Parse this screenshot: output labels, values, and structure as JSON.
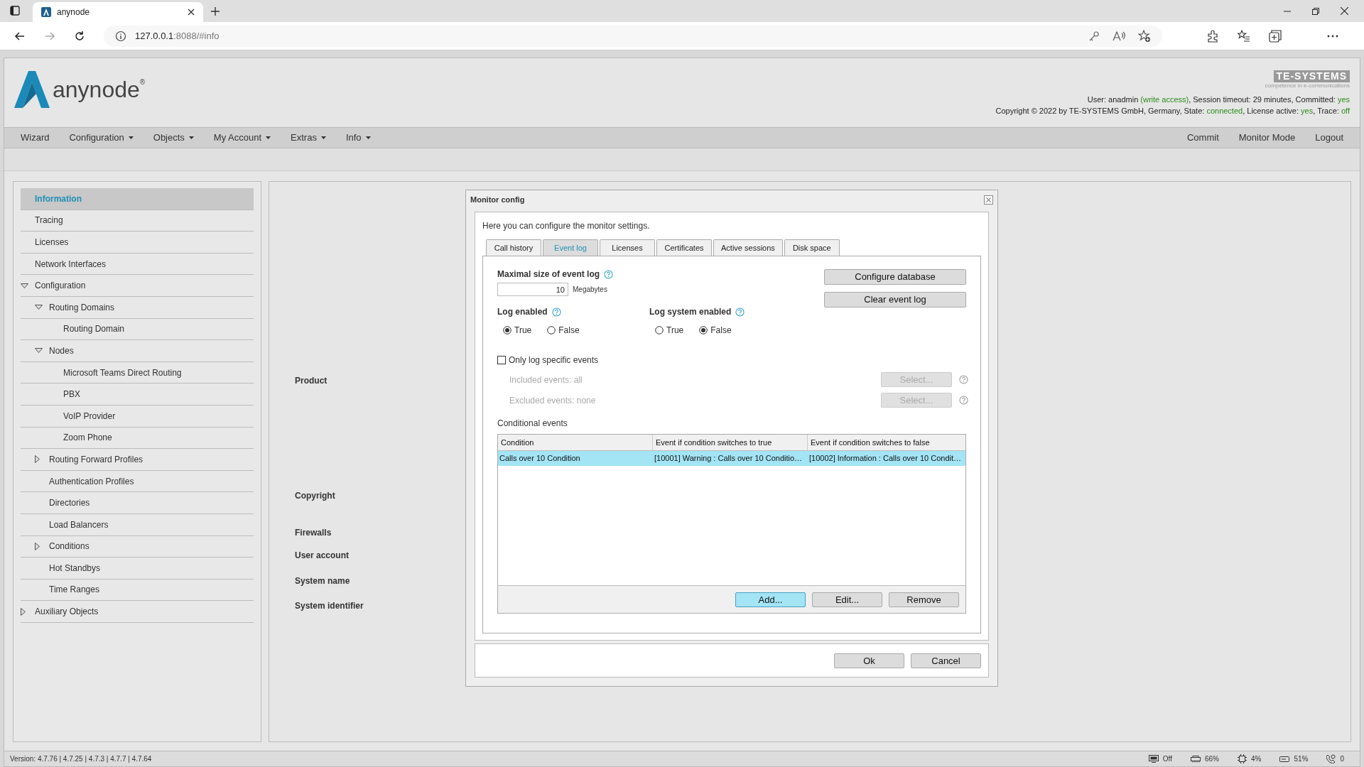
{
  "browser": {
    "tab": {
      "title": "anynode",
      "selected": true
    },
    "address": {
      "host": "127.0.0.1",
      "path": ":8088/#info"
    }
  },
  "header": {
    "logo_text": "anynode",
    "logo_mark": "®",
    "brand": {
      "name": "TE-SYSTEMS",
      "tagline": "competence in e-communications"
    },
    "info_lines": [
      [
        {
          "text": "User: anadmin ",
          "kind": "plain"
        },
        {
          "text": "(write access)",
          "kind": "value"
        },
        {
          "text": ", Session timeout: 29 minutes, Committed: ",
          "kind": "plain"
        },
        {
          "text": "yes",
          "kind": "value"
        }
      ],
      [
        {
          "text": "Copyright © 2022 by TE-SYSTEMS GmbH, Germany, State: ",
          "kind": "plain"
        },
        {
          "text": "connected",
          "kind": "value"
        },
        {
          "text": ", License active: ",
          "kind": "plain"
        },
        {
          "text": "yes",
          "kind": "value"
        },
        {
          "text": ", Trace: ",
          "kind": "plain"
        },
        {
          "text": "off",
          "kind": "value"
        }
      ]
    ]
  },
  "nav": {
    "left": [
      {
        "label": "Wizard",
        "has_menu": false
      },
      {
        "label": "Configuration",
        "has_menu": true
      },
      {
        "label": "Objects",
        "has_menu": true
      },
      {
        "label": "My Account",
        "has_menu": true
      },
      {
        "label": "Extras",
        "has_menu": true
      },
      {
        "label": "Info",
        "has_menu": true
      }
    ],
    "right": [
      {
        "label": "Commit",
        "has_menu": false
      },
      {
        "label": "Monitor Mode",
        "has_menu": false
      },
      {
        "label": "Logout",
        "has_menu": false
      }
    ]
  },
  "sidebar": {
    "items": [
      {
        "label": "Information",
        "selected": true
      },
      {
        "label": "Tracing",
        "selected": false
      },
      {
        "label": "Licenses",
        "selected": false
      },
      {
        "label": "Network Interfaces",
        "selected": false
      },
      {
        "label": "Configuration",
        "selected": false,
        "expanded": true,
        "children": [
          {
            "label": "Routing Domains",
            "selected": false,
            "expanded": true,
            "children": [
              {
                "label": "Routing Domain",
                "selected": false
              }
            ]
          },
          {
            "label": "Nodes",
            "selected": false,
            "expanded": true,
            "children": [
              {
                "label": "Microsoft Teams Direct Routing",
                "selected": false
              },
              {
                "label": "PBX",
                "selected": false
              },
              {
                "label": "VoIP Provider",
                "selected": false
              },
              {
                "label": "Zoom Phone",
                "selected": false
              }
            ]
          },
          {
            "label": "Routing Forward Profiles",
            "selected": false,
            "expanded": false
          },
          {
            "label": "Authentication Profiles",
            "selected": false
          },
          {
            "label": "Directories",
            "selected": false
          },
          {
            "label": "Load Balancers",
            "selected": false
          },
          {
            "label": "Conditions",
            "selected": false,
            "expanded": false
          },
          {
            "label": "Hot Standbys",
            "selected": false
          },
          {
            "label": "Time Ranges",
            "selected": false
          }
        ]
      },
      {
        "label": "Auxiliary Objects",
        "selected": false,
        "expanded": false
      }
    ]
  },
  "main": {
    "labels": [
      "Product",
      "Copyright",
      "Firewalls",
      "User account",
      "System name",
      "System identifier"
    ]
  },
  "dialog": {
    "title": "Monitor config",
    "description": "Here you can configure the monitor settings.",
    "tabs": [
      {
        "label": "Call history",
        "selected": false
      },
      {
        "label": "Event log",
        "selected": true
      },
      {
        "label": "Licenses",
        "selected": false
      },
      {
        "label": "Certificates",
        "selected": false
      },
      {
        "label": "Active sessions",
        "selected": false
      },
      {
        "label": "Disk space",
        "selected": false
      }
    ],
    "max_size": {
      "label": "Maximal size of event log",
      "value": "10",
      "unit": "Megabytes"
    },
    "side_buttons": [
      "Configure database",
      "Clear event log"
    ],
    "radio_groups": [
      {
        "label": "Log enabled",
        "options": [
          {
            "label": "True",
            "selected": true
          },
          {
            "label": "False",
            "selected": false
          }
        ]
      },
      {
        "label": "Log system enabled",
        "options": [
          {
            "label": "True",
            "selected": false
          },
          {
            "label": "False",
            "selected": true
          }
        ]
      }
    ],
    "only_specific": {
      "label": "Only log specific events",
      "checked": false
    },
    "filters": [
      {
        "label": "Included events: all",
        "button": "Select...",
        "disabled": true
      },
      {
        "label": "Excluded events: none",
        "button": "Select...",
        "disabled": true
      }
    ],
    "conditional": {
      "label": "Conditional events",
      "columns": [
        "Condition",
        "Event if condition switches to true",
        "Event if condition switches to false"
      ],
      "rows": [
        {
          "cells": [
            "Calls over 10 Condition",
            "[10001] Warning : Calls over 10 Conditio…",
            "[10002] Information : Calls over 10 Condit…"
          ],
          "selected": true
        }
      ],
      "buttons": [
        {
          "label": "Add...",
          "focused": true
        },
        {
          "label": "Edit...",
          "focused": false
        },
        {
          "label": "Remove",
          "focused": false
        }
      ]
    },
    "footer_buttons": [
      "Ok",
      "Cancel"
    ]
  },
  "status": {
    "version": "Version: 4.7.76 | 4.7.25 | 4.7.3 | 4.7.7 | 4.7.64",
    "indicators": [
      {
        "kind": "display",
        "text": "Off"
      },
      {
        "kind": "memory",
        "text": "66%"
      },
      {
        "kind": "cpu",
        "text": "4%"
      },
      {
        "kind": "disk",
        "text": "51%"
      },
      {
        "kind": "calls",
        "text": "0"
      }
    ]
  }
}
